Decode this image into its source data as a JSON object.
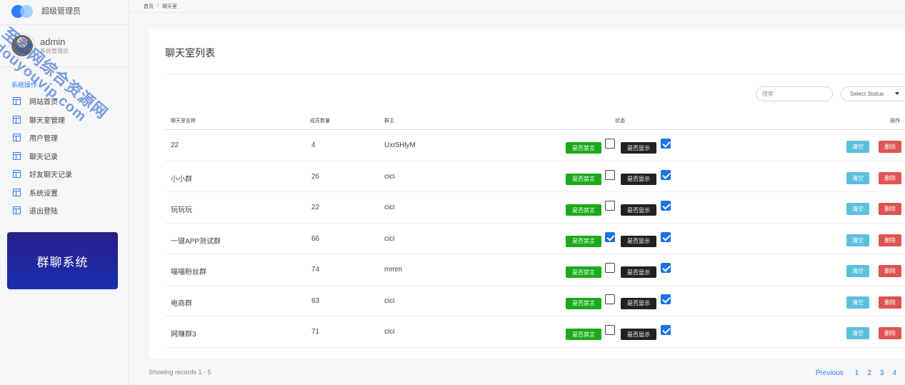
{
  "brand": {
    "title": "超级管理员"
  },
  "user": {
    "name": "admin",
    "role": "系统管理员"
  },
  "nav": {
    "section": "系统操作",
    "items": [
      {
        "label": "网站首页"
      },
      {
        "label": "聊天室管理"
      },
      {
        "label": "用户管理"
      },
      {
        "label": "聊天记录"
      },
      {
        "label": "好友聊天记录"
      },
      {
        "label": "系统设置"
      },
      {
        "label": "退出登陆"
      }
    ]
  },
  "promo": {
    "label": "群聊系统"
  },
  "breadcrumb": {
    "home": "首页",
    "sep": "/",
    "current": "聊天室"
  },
  "card": {
    "title": "聊天室列表"
  },
  "filters": {
    "search_placeholder": "搜索",
    "status_select": "Select Status"
  },
  "table": {
    "headers": {
      "name": "聊天室名称",
      "members": "成员数量",
      "owner": "群主",
      "status": "状态",
      "actions": "操作"
    },
    "mute_label": "是否禁言",
    "show_label": "是否显示",
    "clear_label": "清空",
    "delete_label": "删除",
    "rows": [
      {
        "name": "22",
        "members": "4",
        "owner": "Uxr5HlyM",
        "muted": false,
        "shown": true
      },
      {
        "name": "小小群",
        "members": "26",
        "owner": "cici",
        "muted": false,
        "shown": true
      },
      {
        "name": "玩玩玩",
        "members": "22",
        "owner": "cici",
        "muted": false,
        "shown": true
      },
      {
        "name": "一键APP测试群",
        "members": "66",
        "owner": "cici",
        "muted": true,
        "shown": true
      },
      {
        "name": "喵喵粉丝群",
        "members": "74",
        "owner": "mmm",
        "muted": false,
        "shown": true
      },
      {
        "name": "电商群",
        "members": "63",
        "owner": "cici",
        "muted": false,
        "shown": true
      },
      {
        "name": "网赚群3",
        "members": "71",
        "owner": "cici",
        "muted": false,
        "shown": true
      }
    ]
  },
  "footer": {
    "records": "Showing records 1 - 5"
  },
  "pager": {
    "previous": "Previous",
    "pages": [
      "1",
      "2",
      "3",
      "4"
    ]
  },
  "watermark": {
    "line1": "至都网综合资源网",
    "line2": "douyouvip.com"
  },
  "colors": {
    "accent": "#2e7cf6",
    "mute_button": "#1aaa1a",
    "show_button": "#222222",
    "clear_button": "#5bc0de",
    "delete_button": "#e05353",
    "checkbox_on": "#1a73e8"
  }
}
